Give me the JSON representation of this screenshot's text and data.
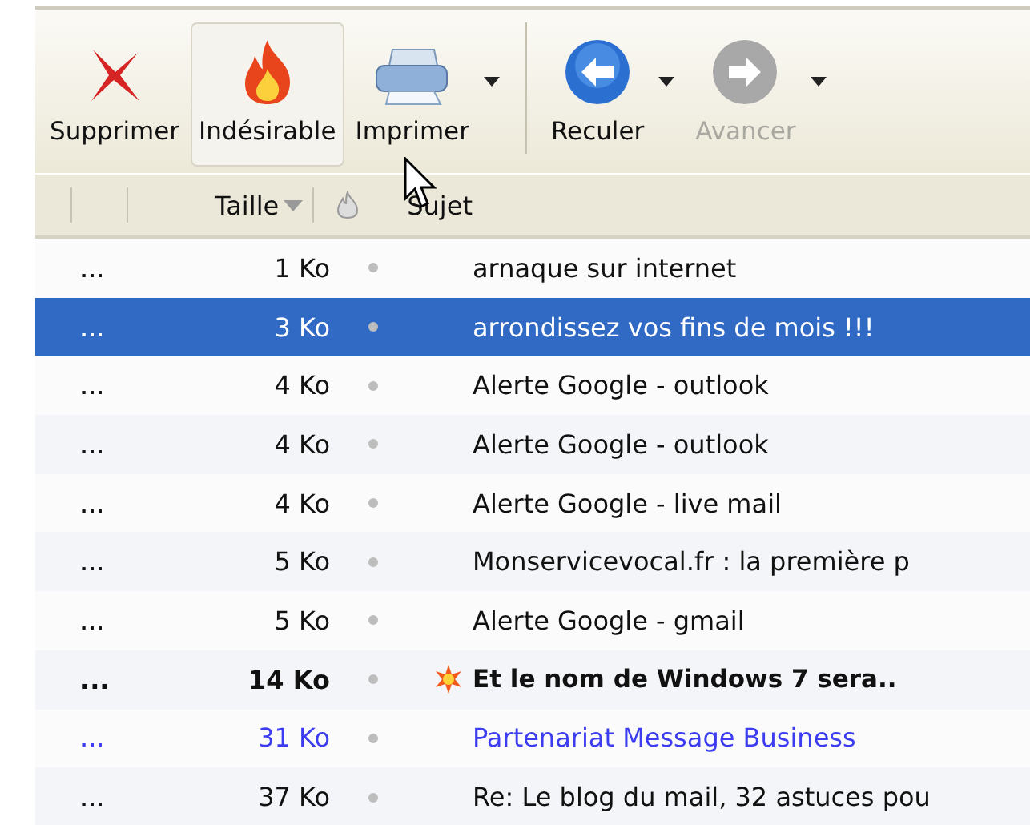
{
  "toolbar": [
    {
      "kind": "delete",
      "label": "Supprimer",
      "hover": false,
      "disabled": false,
      "dropdown": false,
      "separator_after": false
    },
    {
      "kind": "junk",
      "label": "Indésirable",
      "hover": true,
      "disabled": false,
      "dropdown": false,
      "separator_after": false
    },
    {
      "kind": "print",
      "label": "Imprimer",
      "hover": false,
      "disabled": false,
      "dropdown": true,
      "separator_after": true
    },
    {
      "kind": "back",
      "label": "Reculer",
      "hover": false,
      "disabled": false,
      "dropdown": true,
      "separator_after": false
    },
    {
      "kind": "forward",
      "label": "Avancer",
      "hover": false,
      "disabled": true,
      "dropdown": true,
      "separator_after": false
    }
  ],
  "columns": {
    "size": "Taille",
    "subject": "Sujet"
  },
  "rows": [
    {
      "col1": "...",
      "size": "1 Ko",
      "subject": "arnaque sur internet",
      "kind": "plain",
      "selected": false,
      "starred": false
    },
    {
      "col1": "...",
      "size": "3 Ko",
      "subject": "arrondissez vos fins de mois !!!",
      "kind": "plain",
      "selected": true,
      "starred": false
    },
    {
      "col1": "...",
      "size": "4 Ko",
      "subject": "Alerte Google - outlook",
      "kind": "plain",
      "selected": false,
      "starred": false
    },
    {
      "col1": "...",
      "size": "4 Ko",
      "subject": "Alerte Google - outlook",
      "kind": "plain",
      "selected": false,
      "starred": false
    },
    {
      "col1": "...",
      "size": "4 Ko",
      "subject": "Alerte Google - live mail",
      "kind": "plain",
      "selected": false,
      "starred": false
    },
    {
      "col1": "...",
      "size": "5 Ko",
      "subject": "Monservicevocal.fr : la première p",
      "kind": "plain",
      "selected": false,
      "starred": false
    },
    {
      "col1": "...",
      "size": "5 Ko",
      "subject": "Alerte Google - gmail",
      "kind": "plain",
      "selected": false,
      "starred": false
    },
    {
      "col1": "...",
      "size": "14 Ko",
      "subject": "Et le nom de Windows 7 sera..",
      "kind": "unread",
      "selected": false,
      "starred": true
    },
    {
      "col1": "...",
      "size": "31 Ko",
      "subject": "Partenariat Message Business",
      "kind": "blue",
      "selected": false,
      "starred": false
    },
    {
      "col1": "...",
      "size": "37 Ko",
      "subject": "Re: Le blog du mail, 32 astuces pou",
      "kind": "plain",
      "selected": false,
      "starred": false
    }
  ]
}
